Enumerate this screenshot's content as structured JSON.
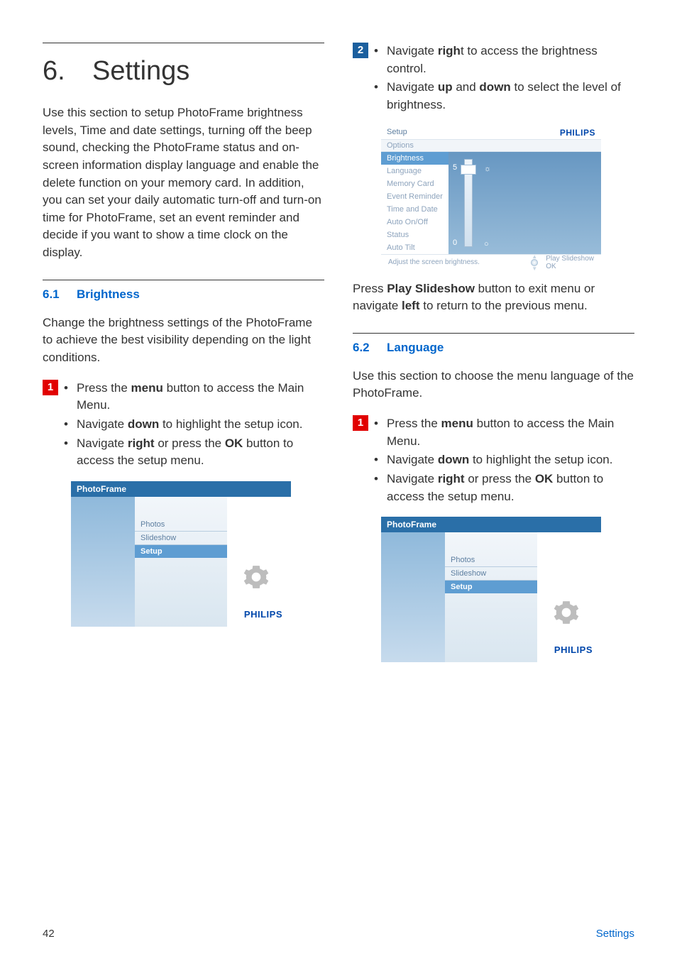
{
  "chapter": {
    "number": "6.",
    "title": "Settings"
  },
  "intro": "Use this section to setup PhotoFrame brightness levels, Time and date settings, turning off the beep sound, checking the PhotoFrame status and on-screen information display language and enable the delete function on your memory card. In addition, you can set your daily automatic turn-off and turn-on time for PhotoFrame, set an event reminder and decide if you want to show a time clock on the display.",
  "left": {
    "sec_num": "6.1",
    "sec_title": "Brightness",
    "sec_intro": "Change the brightness settings of the PhotoFrame to achieve the best visibility depending on the light conditions.",
    "step1_num": "1",
    "bullets": [
      {
        "dot": "•",
        "t1": "Press the ",
        "b1": "menu",
        "t2": " button to access the Main Menu."
      },
      {
        "dot": "•",
        "t1": "Navigate ",
        "b1": "down",
        "t2": " to highlight the setup icon."
      },
      {
        "dot": "•",
        "t1": "Navigate ",
        "b1": "right",
        "t2": " or press the ",
        "b2": "OK",
        "t3": " button to access the setup menu."
      }
    ]
  },
  "right": {
    "step2_num": "2",
    "bullets2": [
      {
        "dot": "•",
        "t1": "Navigate ",
        "b1": "righ",
        "t2": "t to access the brightness control."
      },
      {
        "dot": "•",
        "t1": "Navigate ",
        "b1": "up",
        "t2": " and ",
        "b2": "down",
        "t3": " to select the level of brightness."
      }
    ],
    "after_img_t1": "Press ",
    "after_img_b1": "Play Slideshow",
    "after_img_t2": " button to exit menu or navigate ",
    "after_img_b2": "left",
    "after_img_t3": " to return to the previous menu.",
    "sec_num": "6.2",
    "sec_title": "Language",
    "sec_intro": "Use this section to choose the menu language of the PhotoFrame.",
    "step1_num": "1",
    "bullets3": [
      {
        "dot": "•",
        "t1": "Press the ",
        "b1": "menu",
        "t2": " button to access the Main Menu."
      },
      {
        "dot": "•",
        "t1": "Navigate ",
        "b1": "down",
        "t2": " to highlight the setup icon."
      },
      {
        "dot": "•",
        "t1": "Navigate ",
        "b1": "right",
        "b2": "OK",
        "t2": " or press the ",
        "t3": " button to access the setup menu."
      }
    ]
  },
  "screenshot_menu": {
    "title": "PhotoFrame",
    "items": {
      "photos": "Photos",
      "slideshow": "Slideshow",
      "setup": "Setup"
    },
    "brand": "PHILIPS"
  },
  "screenshot_bright": {
    "title": "Setup",
    "subtitle": "Options",
    "side": {
      "brightness": "Brightness",
      "language": "Language",
      "memory": "Memory Card",
      "event": "Event Reminder",
      "time": "Time and Date",
      "auto": "Auto On/Off",
      "status": "Status",
      "tilt": "Auto Tilt"
    },
    "slider_top": "5",
    "slider_bot": "0",
    "footer_left": "Adjust the screen brightness.",
    "footer_play": "Play Slideshow",
    "footer_ok": "OK",
    "brand": "PHILIPS"
  },
  "footer": {
    "page": "42",
    "section": "Settings"
  }
}
